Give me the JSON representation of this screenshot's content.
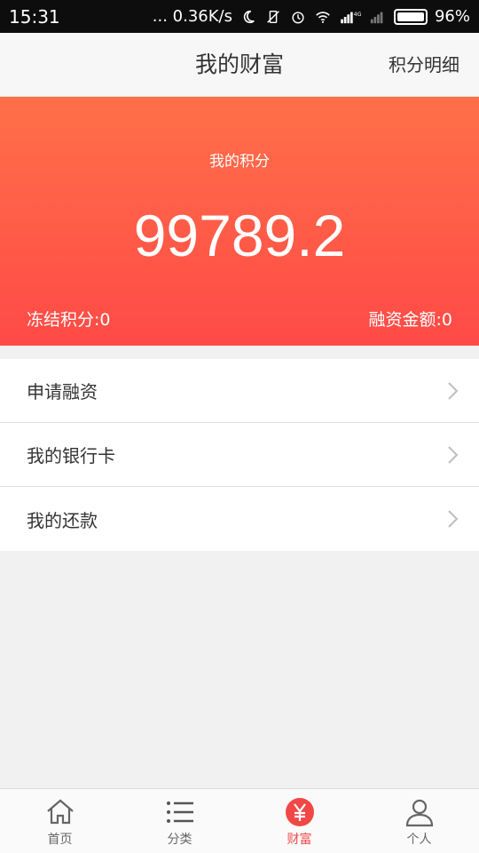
{
  "status_bar": {
    "time": "15:31",
    "speed": "... 0.36K/s",
    "network": "4G 1X",
    "battery": "96%"
  },
  "nav": {
    "title": "我的财富",
    "action": "积分明细"
  },
  "card": {
    "label": "我的积分",
    "value": "99789.2",
    "frozen": "冻结积分:0",
    "finance": "融资金额:0"
  },
  "menu": {
    "items": [
      {
        "label": "申请融资"
      },
      {
        "label": "我的银行卡"
      },
      {
        "label": "我的还款"
      }
    ]
  },
  "tabs": [
    {
      "label": "首页",
      "icon": "home-icon"
    },
    {
      "label": "分类",
      "icon": "list-icon"
    },
    {
      "label": "财富",
      "icon": "yen-icon"
    },
    {
      "label": "个人",
      "icon": "user-icon"
    }
  ],
  "colors": {
    "accent": "#f24845",
    "card_top": "#ff7048",
    "card_bottom": "#ff4a47"
  }
}
